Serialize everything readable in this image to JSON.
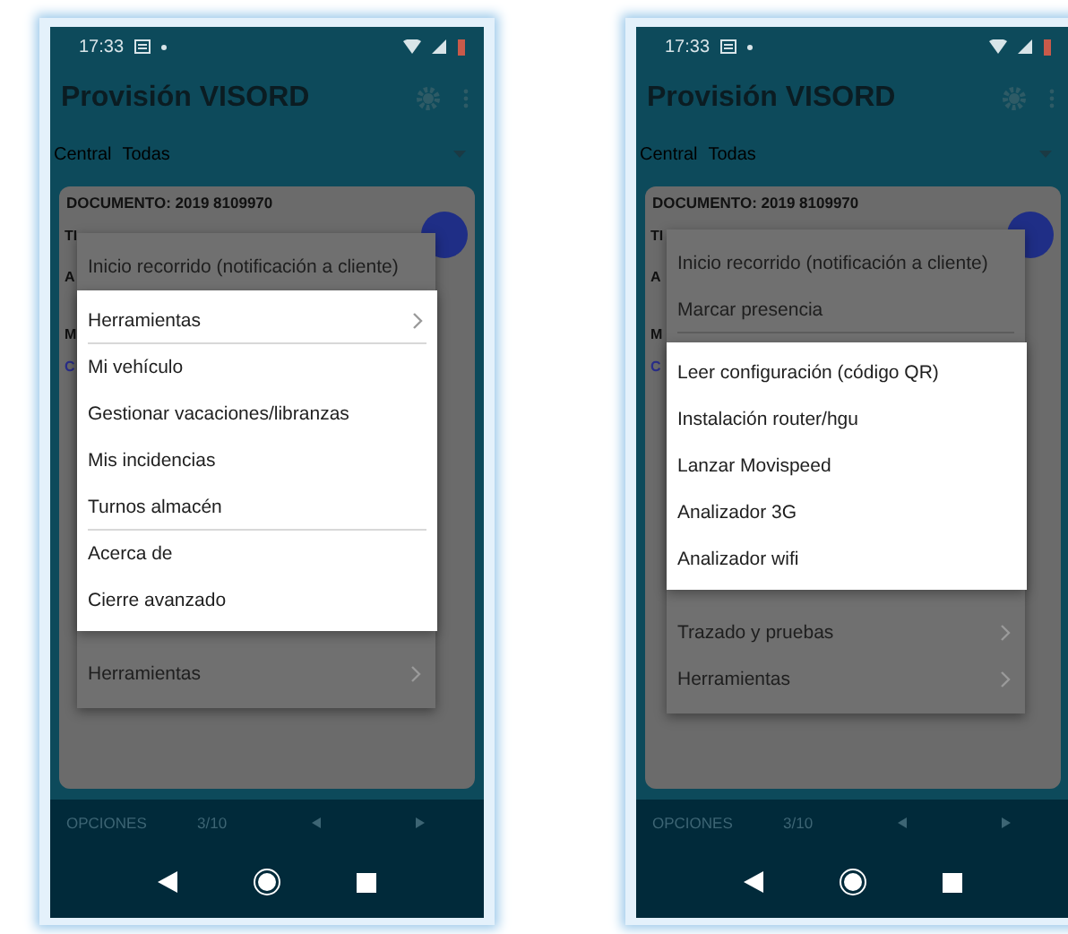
{
  "phones": [
    {
      "status": {
        "time": "17:33"
      },
      "app_bar": {
        "title": "Provisión VISORD"
      },
      "filter": {
        "label": "Central",
        "value": "Todas"
      },
      "card": {
        "document": "DOCUMENTO: 2019 8109970",
        "fragments": [
          {
            "text": "TI",
            "kind": "label"
          },
          {
            "text": "A",
            "kind": "label"
          },
          {
            "text": "M",
            "kind": "label"
          },
          {
            "text": "C",
            "kind": "link"
          }
        ]
      },
      "menu": {
        "top_items": [
          {
            "label": "Inicio recorrido (notificación a cliente)",
            "chevron": false,
            "divider_after": false
          }
        ],
        "bottom_items": [
          {
            "label": "Herramientas",
            "chevron": true,
            "divider_after": false
          }
        ]
      },
      "submenu": {
        "items": [
          {
            "label": "Herramientas",
            "chevron": true,
            "divider_after": true
          },
          {
            "label": "Mi vehículo",
            "chevron": false,
            "divider_after": false
          },
          {
            "label": "Gestionar vacaciones/libranzas",
            "chevron": false,
            "divider_after": false
          },
          {
            "label": "Mis incidencias",
            "chevron": false,
            "divider_after": false
          },
          {
            "label": "Turnos almacén",
            "chevron": false,
            "divider_after": true
          },
          {
            "label": "Acerca de",
            "chevron": false,
            "divider_after": false
          },
          {
            "label": "Cierre avanzado",
            "chevron": false,
            "divider_after": false
          }
        ]
      },
      "footer": {
        "options": "OPCIONES",
        "page": "3/10"
      }
    },
    {
      "status": {
        "time": "17:33"
      },
      "app_bar": {
        "title": "Provisión VISORD"
      },
      "filter": {
        "label": "Central",
        "value": "Todas"
      },
      "card": {
        "document": "DOCUMENTO: 2019 8109970",
        "fragments": [
          {
            "text": "TI",
            "kind": "label"
          },
          {
            "text": "A",
            "kind": "label"
          },
          {
            "text": "M",
            "kind": "label"
          },
          {
            "text": "C",
            "kind": "link"
          }
        ]
      },
      "menu": {
        "top_items": [
          {
            "label": "Inicio recorrido (notificación a cliente)",
            "chevron": false,
            "divider_after": false
          },
          {
            "label": "Marcar presencia",
            "chevron": false,
            "divider_after": true
          }
        ],
        "bottom_items": [
          {
            "label": "Trazado y pruebas",
            "chevron": true,
            "divider_after": false
          },
          {
            "label": "Herramientas",
            "chevron": true,
            "divider_after": false
          }
        ]
      },
      "submenu": {
        "items": [
          {
            "label": "Leer configuración (código QR)",
            "chevron": false,
            "divider_after": false
          },
          {
            "label": "Instalación router/hgu",
            "chevron": false,
            "divider_after": false
          },
          {
            "label": "Lanzar Movispeed",
            "chevron": false,
            "divider_after": false
          },
          {
            "label": "Analizador 3G",
            "chevron": false,
            "divider_after": false
          },
          {
            "label": "Analizador wifi",
            "chevron": false,
            "divider_after": false
          }
        ]
      },
      "footer": {
        "options": "OPCIONES",
        "page": "3/10"
      }
    }
  ]
}
